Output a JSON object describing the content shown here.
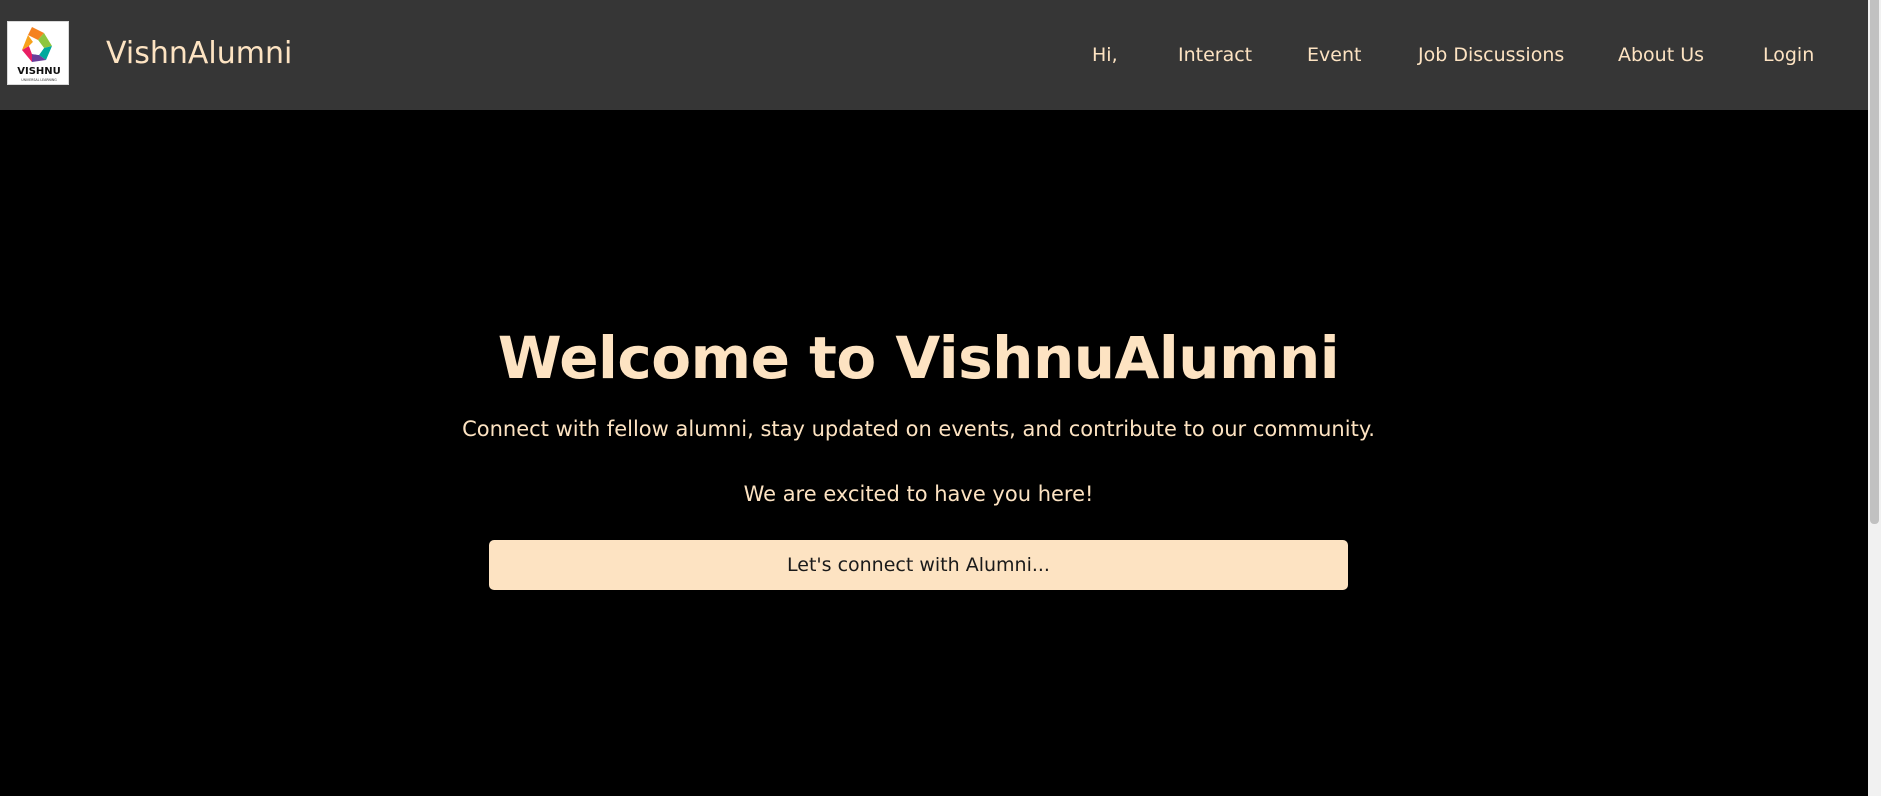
{
  "navbar": {
    "logo": {
      "icon": "vishnu-logo-icon",
      "text": "VISHNU",
      "tagline": "UNIVERSAL LEARNING"
    },
    "brand": "VishnAlumni",
    "items": [
      {
        "label": "Hi,"
      },
      {
        "label": "Interact"
      },
      {
        "label": "Event"
      },
      {
        "label": "Job Discussions"
      },
      {
        "label": "About Us"
      },
      {
        "label": "Login"
      }
    ]
  },
  "hero": {
    "title": "Welcome to VishnuAlumni",
    "subtitle": "Connect with fellow alumni, stay updated on events, and contribute to our community.",
    "tagline": "We are excited to have you here!",
    "cta_label": "Let's connect with Alumni..."
  },
  "colors": {
    "navbar_bg": "#363636",
    "page_bg": "#000000",
    "accent": "#fde3c2",
    "button_text": "#1a1a1a"
  }
}
